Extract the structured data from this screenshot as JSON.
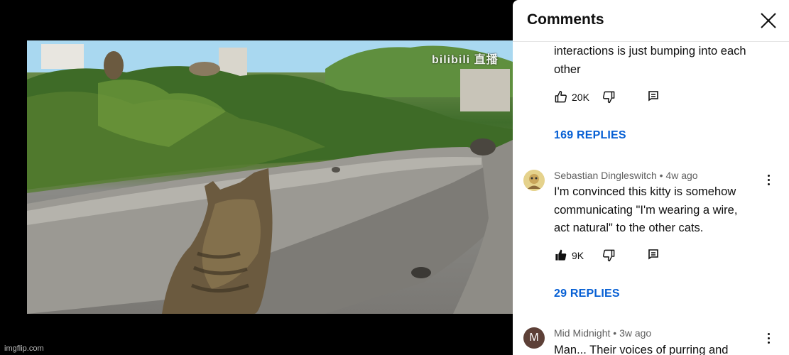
{
  "video": {
    "watermark": "bilibili 直播",
    "footer_credit": "imgflip.com"
  },
  "comments_panel": {
    "title": "Comments",
    "close_icon": "close-icon",
    "comments": [
      {
        "author": "",
        "age": "",
        "text_lines": [
          "interactions is just bumping into each",
          "other"
        ],
        "likes": "20K",
        "liked": false,
        "replies_label": "169 REPLIES"
      },
      {
        "author": "Sebastian Dingleswitch",
        "age": "4w ago",
        "text_lines": [
          "I'm convinced this kitty is somehow",
          "communicating \"I'm wearing a wire,",
          "act natural\" to the other cats."
        ],
        "likes": "9K",
        "liked": true,
        "replies_label": "29 REPLIES",
        "avatar_color": "#d8c27a"
      },
      {
        "author": "Mid Midnight",
        "age": "3w ago",
        "avatar_letter": "M",
        "avatar_color": "#5d4037",
        "text_lines": [
          "Man... Their voices of purring and"
        ]
      }
    ]
  },
  "colors": {
    "accent_link": "#065fd4",
    "text_primary": "#0f0f0f",
    "text_secondary": "#606060"
  }
}
